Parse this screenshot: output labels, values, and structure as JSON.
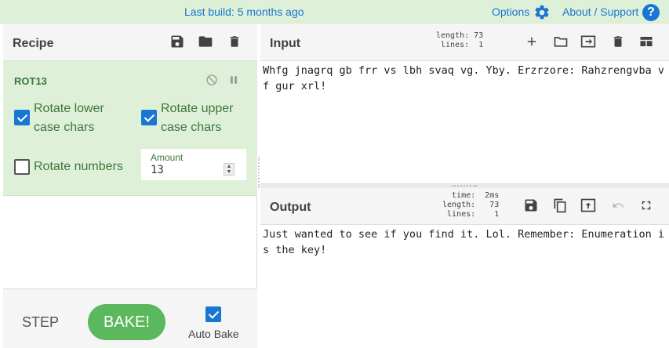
{
  "topbar": {
    "build": "Last build: 5 months ago",
    "options": "Options",
    "about": "About / Support",
    "help_glyph": "?"
  },
  "recipe": {
    "title": "Recipe",
    "icons": [
      "save-icon",
      "folder-icon",
      "trash-icon"
    ],
    "operation": {
      "name": "ROT13",
      "lower_label_1": "Rotate lower",
      "lower_label_2": "case chars",
      "upper_label_1": "Rotate upper",
      "upper_label_2": "case chars",
      "numbers_label": "Rotate numbers",
      "rotate_lower": true,
      "rotate_upper": true,
      "rotate_numbers": false,
      "amount_label": "Amount",
      "amount_value": "13"
    },
    "step": "STEP",
    "bake": "BAKE!",
    "auto_bake": "Auto Bake",
    "auto_bake_checked": true
  },
  "input": {
    "title": "Input",
    "stats": "length: 73\n lines:  1",
    "text": "Whfg jnagrq gb frr vs lbh svaq vg. Yby. Erzrzore: Rahzrengvba vf gur xrl!"
  },
  "output": {
    "title": "Output",
    "stats": "  time:  2ms\nlength:   73\n lines:    1",
    "text": "Just wanted to see if you find it. Lol. Remember: Enumeration is the key!"
  },
  "colors": {
    "accent": "#1976d2",
    "op_bg": "#dff0d8",
    "op_text": "#3c763d",
    "bake": "#5cb85c"
  }
}
